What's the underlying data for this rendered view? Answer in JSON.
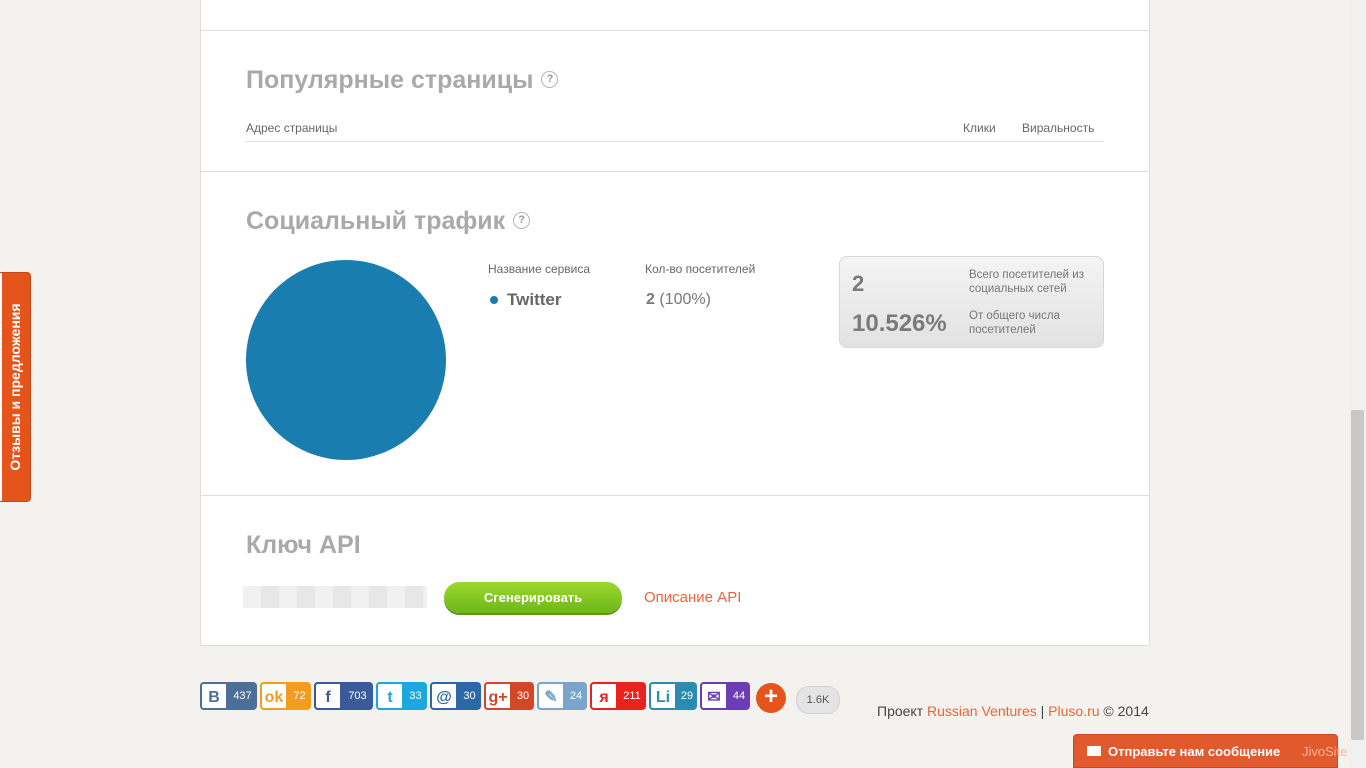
{
  "popular": {
    "title": "Популярные страницы",
    "help": "?",
    "col_url": "Адрес страницы",
    "col_clicks": "Клики",
    "col_viral": "Виральность"
  },
  "social": {
    "title": "Социальный трафик",
    "help": "?",
    "col_service": "Название сервиса",
    "col_visitors": "Кол-во посетителей",
    "rows": [
      {
        "service": "Twitter",
        "count": "2",
        "pct": "(100%)",
        "color": "#1a7db0"
      }
    ],
    "total_value": "2",
    "total_label": "Всего посетителей из социальных сетей",
    "share_value": "10.526%",
    "share_label": "От общего числа посетителей"
  },
  "chart_data": {
    "type": "pie",
    "categories": [
      "Twitter"
    ],
    "values": [
      100
    ],
    "colors": [
      "#1a7db0"
    ]
  },
  "api": {
    "title": "Ключ API",
    "generate_label": "Сгенерировать",
    "docs_link": "Описание API"
  },
  "feedback_tab": "Отзывы и предложения",
  "share_buttons": [
    {
      "icon": "vk-icon",
      "glyph": "B",
      "count": "437",
      "color": "#4b6f96"
    },
    {
      "icon": "odnoklassniki-icon",
      "glyph": "ok",
      "count": "72",
      "color": "#f39d1e"
    },
    {
      "icon": "facebook-icon",
      "glyph": "f",
      "count": "703",
      "color": "#3b5a99"
    },
    {
      "icon": "twitter-icon",
      "glyph": "t",
      "count": "33",
      "color": "#1da7e0"
    },
    {
      "icon": "mailru-icon",
      "glyph": "@",
      "count": "30",
      "color": "#2c68a7"
    },
    {
      "icon": "google-plus-icon",
      "glyph": "g+",
      "count": "30",
      "color": "#d34628"
    },
    {
      "icon": "livejournal-icon",
      "glyph": "✎",
      "count": "24",
      "color": "#7aa5c9"
    },
    {
      "icon": "yandex-icon",
      "glyph": "я",
      "count": "211",
      "color": "#e8231d"
    },
    {
      "icon": "linkedin-icon",
      "glyph": "Li",
      "count": "29",
      "color": "#2b8cb0"
    },
    {
      "icon": "mail-icon",
      "glyph": "✉",
      "count": "44",
      "color": "#6c3db5"
    }
  ],
  "share_total": "1.6K",
  "footer": {
    "prefix": "Проект",
    "link1": "Russian Ventures",
    "sep": "|",
    "link2": "Pluso.ru",
    "copy": "© 2014"
  },
  "jivo": {
    "message": "Отправьте нам сообщение",
    "brand": "JivoSite"
  }
}
